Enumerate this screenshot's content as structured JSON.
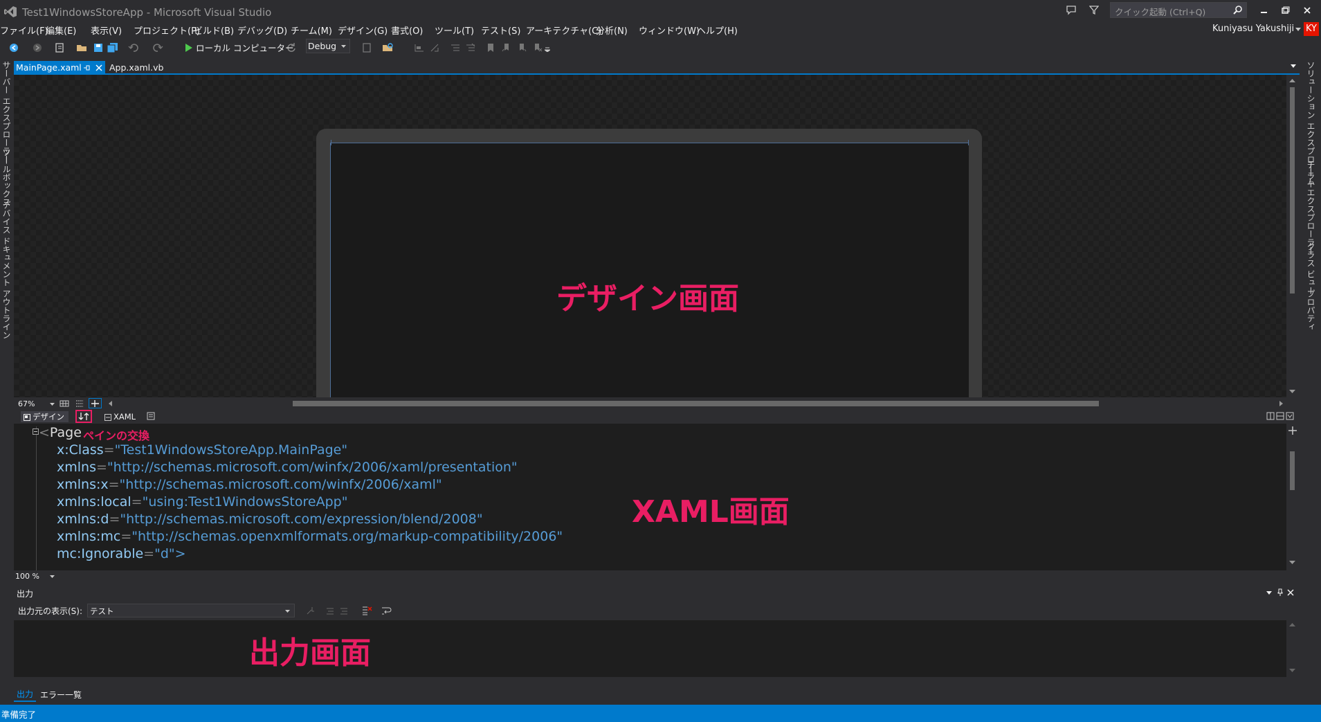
{
  "window": {
    "title": "Test1WindowsStoreApp - Microsoft Visual Studio"
  },
  "quick_launch": {
    "placeholder": "クイック起動 (Ctrl+Q)"
  },
  "menu": [
    "ファイル(F)",
    "編集(E)",
    "表示(V)",
    "プロジェクト(P)",
    "ビルド(B)",
    "デバッグ(D)",
    "チーム(M)",
    "デザイン(G)",
    "書式(O)",
    "ツール(T)",
    "テスト(S)",
    "アーキテクチャ(C)",
    "分析(N)",
    "ウィンドウ(W)",
    "ヘルプ(H)"
  ],
  "user": {
    "name": "Kuniyasu Yakushiji",
    "initials": "KY",
    "avatar_color": "#e51400"
  },
  "toolbar": {
    "run_label": "ローカル コンピューター",
    "config": "Debug"
  },
  "left_tabs": [
    "サーバー エクスプローラー",
    "ツールボックス",
    "デバイス",
    "ドキュメント アウトライン"
  ],
  "right_tabs": [
    "ソリューション エクスプローラー",
    "チーム エクスプローラー",
    "クラス ビュー",
    "プロパティ"
  ],
  "doc_tabs": [
    {
      "label": "MainPage.xaml",
      "active": true
    },
    {
      "label": "App.xaml.vb",
      "active": false
    }
  ],
  "design_pane": {
    "annotation": "デザイン画面",
    "zoom": "67%"
  },
  "split_bar": {
    "design_tab": "デザイン",
    "xaml_tab": "XAML",
    "swap_annotation": "ペインの交換"
  },
  "xaml_code": {
    "tag": "Page",
    "lines": [
      {
        "attr": "x:Class",
        "value": "\"Test1WindowsStoreApp.MainPage\""
      },
      {
        "attr": "xmlns",
        "value": "\"http://schemas.microsoft.com/winfx/2006/xaml/presentation\""
      },
      {
        "attr": "xmlns:x",
        "value": "\"http://schemas.microsoft.com/winfx/2006/xaml\""
      },
      {
        "attr": "xmlns:local",
        "value": "\"using:Test1WindowsStoreApp\""
      },
      {
        "attr": "xmlns:d",
        "value": "\"http://schemas.microsoft.com/expression/blend/2008\""
      },
      {
        "attr": "xmlns:mc",
        "value": "\"http://schemas.openxmlformats.org/markup-compatibility/2006\""
      },
      {
        "attr": "mc:Ignorable",
        "value": "\"d\">"
      }
    ],
    "annotation": "XAML画面",
    "zoom": "100 %"
  },
  "output_pane": {
    "title": "出力",
    "source_label": "出力元の表示(S):",
    "source_value": "テスト",
    "annotation": "出力画面",
    "tabs": [
      "出力",
      "エラー一覧"
    ]
  },
  "status_bar": {
    "text": "準備完了"
  },
  "colors": {
    "accent": "#007acc",
    "annotation": "#e91e63",
    "background": "#2d2d30",
    "editor": "#1e1e1e"
  }
}
